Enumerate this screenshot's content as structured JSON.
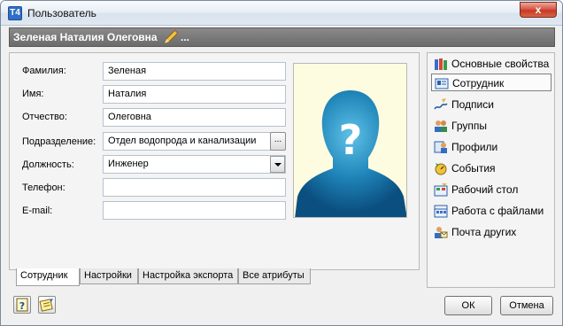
{
  "window": {
    "title": "Пользователь",
    "app_icon_text": "Т4",
    "close_glyph": "x"
  },
  "header": {
    "user_name": "Зеленая Наталия Олеговна",
    "dots": "..."
  },
  "form": {
    "fields": [
      {
        "label": "Фамилия:",
        "value": "Зеленая"
      },
      {
        "label": "Имя:",
        "value": "Наталия"
      },
      {
        "label": "Отчество:",
        "value": "Олеговна"
      },
      {
        "label": "Подразделение:",
        "value": "Отдел водопрода и канализации"
      },
      {
        "label": "Должность:",
        "value": "Инженер"
      },
      {
        "label": "Телефон:",
        "value": ""
      },
      {
        "label": "E-mail:",
        "value": ""
      }
    ],
    "browse_button": "...",
    "photo": {
      "glyph": "?",
      "icon": "person-silhouette-icon"
    }
  },
  "tabs": [
    {
      "label": "Сотрудник",
      "active": true
    },
    {
      "label": "Настройки",
      "active": false
    },
    {
      "label": "Настройка экспорта",
      "active": false
    },
    {
      "label": "Все атрибуты",
      "active": false
    }
  ],
  "nav": [
    {
      "label": "Основные свойства",
      "icon": "books-icon",
      "selected": false
    },
    {
      "label": "Сотрудник",
      "icon": "id-card-icon",
      "selected": true
    },
    {
      "label": "Подписи",
      "icon": "signature-icon",
      "selected": false
    },
    {
      "label": "Группы",
      "icon": "group-icon",
      "selected": false
    },
    {
      "label": "Профили",
      "icon": "profile-icon",
      "selected": false
    },
    {
      "label": "События",
      "icon": "events-icon",
      "selected": false
    },
    {
      "label": "Рабочий стол",
      "icon": "desktop-icon",
      "selected": false
    },
    {
      "label": "Работа с файлами",
      "icon": "files-icon",
      "selected": false
    },
    {
      "label": "Почта других",
      "icon": "mail-icon",
      "selected": false
    }
  ],
  "buttons": {
    "ok": "ОК",
    "cancel": "Отмена"
  },
  "colors": {
    "header_bar": "#777777",
    "photo_bg": "#fdfce0",
    "silhouette": "#1f84b8"
  }
}
